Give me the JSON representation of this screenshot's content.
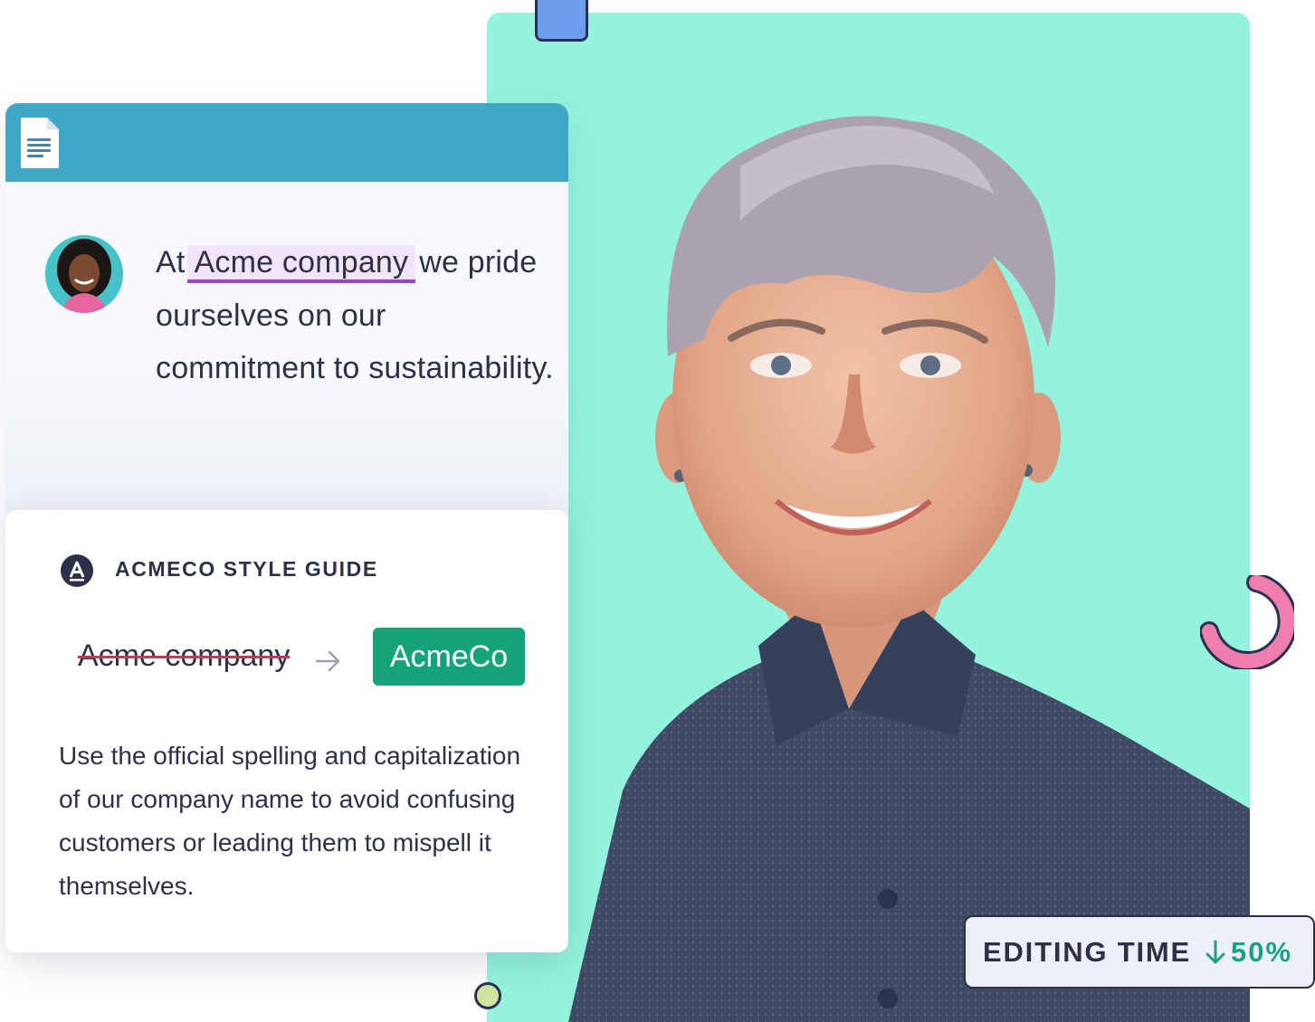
{
  "doc": {
    "text_before": "At",
    "highlight": "Acme company",
    "text_after": "we pride ourselves on our commitment to sustainability."
  },
  "style_guide": {
    "title": "ACMECO STYLE GUIDE",
    "struck_term": "Acme company",
    "replacement": "AcmeCo",
    "body": "Use the official spelling and capitalization of our company name to avoid confusing customers or leading them to mispell it themselves."
  },
  "badge": {
    "label": "EDITING TIME",
    "value": "50%"
  },
  "colors": {
    "doc_header": "#41a7c6",
    "photo_bg": "#93f3dd",
    "highlight_bg": "#f3e3fb",
    "highlight_underline": "#9b45c8",
    "accept_green": "#15a37a",
    "strike_red": "#d1344c",
    "badge_value": "#19a08a",
    "text_dark": "#2c3148"
  },
  "icons": [
    "document-icon",
    "style-guide-logo-icon",
    "arrow-right-icon",
    "arrow-down-icon"
  ]
}
